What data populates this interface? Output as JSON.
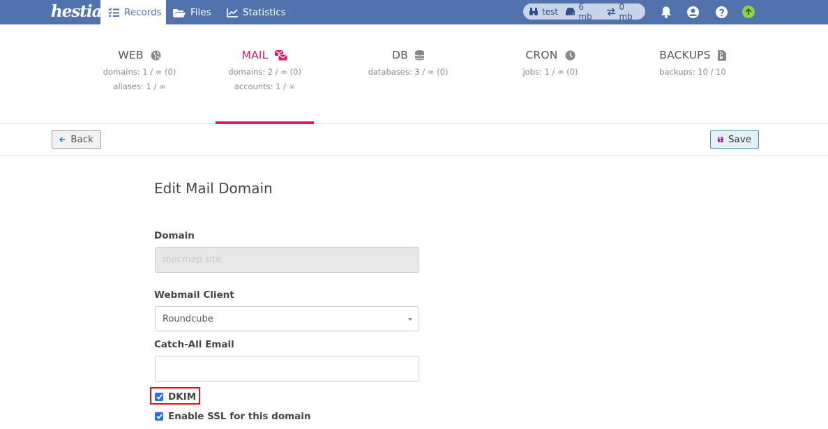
{
  "topbar": {
    "logo": "hestia",
    "nav": [
      {
        "label": "Records",
        "icon": "list-check-icon",
        "active": true
      },
      {
        "label": "Files",
        "icon": "folder-open-icon",
        "active": false
      },
      {
        "label": "Statistics",
        "icon": "chart-line-icon",
        "active": false
      }
    ],
    "usage": {
      "user": "test",
      "disk": "6 mb",
      "bandwidth": "0 mb"
    },
    "icons": [
      "bell-icon",
      "user-circle-icon",
      "question-circle-icon",
      "arrow-up-circle-icon"
    ]
  },
  "stats": [
    {
      "title": "WEB",
      "icon": "globe-icon",
      "lines": [
        "domains: 1 / ∞ (0)",
        "aliases: 1 / ∞"
      ],
      "active": false
    },
    {
      "title": "MAIL",
      "icon": "envelopes-icon",
      "lines": [
        "domains: 2 / ∞ (0)",
        "accounts: 1 / ∞"
      ],
      "active": true
    },
    {
      "title": "DB",
      "icon": "database-icon",
      "lines": [
        "databases: 3 / ∞ (0)"
      ],
      "active": false
    },
    {
      "title": "CRON",
      "icon": "clock-icon",
      "lines": [
        "jobs: 1 / ∞ (0)"
      ],
      "active": false
    },
    {
      "title": "BACKUPS",
      "icon": "file-archive-icon",
      "lines": [
        "backups: 10 / 10"
      ],
      "active": false
    }
  ],
  "toolbar": {
    "back_label": "Back",
    "save_label": "Save"
  },
  "form": {
    "title": "Edit Mail Domain",
    "domain_label": "Domain",
    "domain_value": "mecmep.site",
    "webmail_label": "Webmail Client",
    "webmail_value": "Roundcube",
    "catchall_label": "Catch-All Email",
    "catchall_value": "",
    "dkim_label": "DKIM",
    "dkim_checked": true,
    "ssl_label": "Enable SSL for this domain",
    "ssl_checked": true
  },
  "colors": {
    "topbar": "#5172ad",
    "accent_mail": "#d6186a",
    "highlight": "#d9141c",
    "checkbox": "#2a6fdb"
  }
}
